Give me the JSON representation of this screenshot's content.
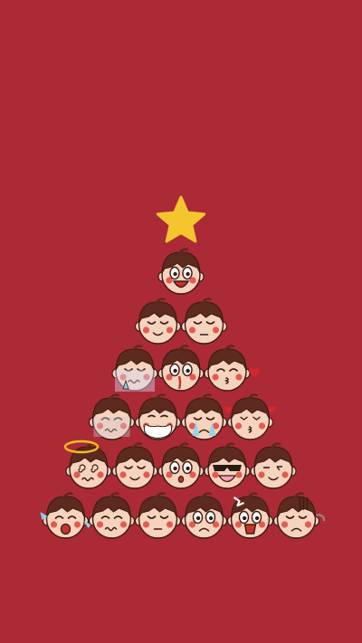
{
  "colors": {
    "background": "#ab2a36",
    "star": "#f5c52e",
    "skin": "#f6d3bd",
    "hair": "#5c2a1e",
    "outline": "#3b1a12",
    "cheek": "#e0453b",
    "mouth": "#c8322b",
    "tear": "#8fd0ef",
    "halo": "#f2c21b",
    "heart": "#d7262b",
    "glasses": "#2a1a14"
  },
  "tree": {
    "topper": "star-icon",
    "rows": [
      {
        "faces": [
          "grin"
        ]
      },
      {
        "faces": [
          "sleepy",
          "calm"
        ]
      },
      {
        "faces": [
          "cold",
          "shocked",
          "kiss-heart"
        ]
      },
      {
        "faces": [
          "worried",
          "beard",
          "crying",
          "love-kiss"
        ]
      },
      {
        "faces": [
          "dizzy",
          "smug",
          "surprised",
          "sunglasses",
          "wink"
        ]
      },
      {
        "faces": [
          "laugh-cry",
          "wavy-mouth",
          "content",
          "frown",
          "angry-shout",
          "gloomy"
        ]
      }
    ]
  }
}
